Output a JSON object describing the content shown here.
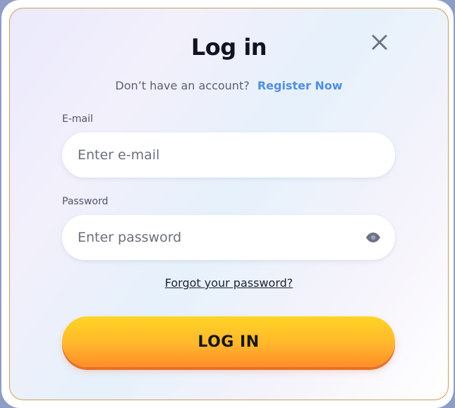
{
  "modal": {
    "title": "Log in",
    "register_prompt": "Don’t have an account?",
    "register_link": "Register Now"
  },
  "email": {
    "label": "E-mail",
    "placeholder": "Enter e-mail"
  },
  "password": {
    "label": "Password",
    "placeholder": "Enter password"
  },
  "forgot_password": "Forgot your password?",
  "login_button": "LOG IN",
  "icons": {
    "close": "close-icon",
    "password_visibility": "eye-icon"
  },
  "colors": {
    "accent_link": "#4f8ee3",
    "button_top": "#ffd525",
    "button_bottom": "#ff8d2a",
    "border": "#cf9a5e"
  }
}
